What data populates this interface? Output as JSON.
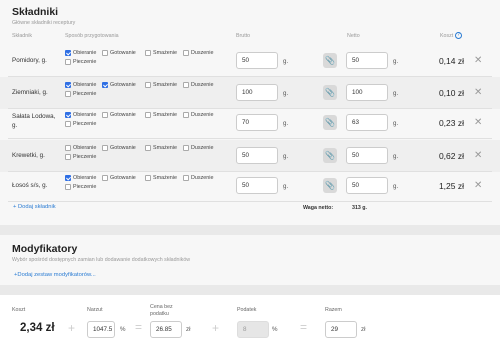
{
  "ingredients": {
    "title": "Składniki",
    "subtitle": "Główne składniki receptury",
    "headers": {
      "name": "Składnik",
      "method": "Sposób przygotowania",
      "brutto": "Brutto",
      "netto": "Netto",
      "cost": "Koszt"
    },
    "help_icon": "?",
    "method_labels": [
      "Obieranie",
      "Gotowanie",
      "Smażenie",
      "Duszenie",
      "Pieczenie"
    ],
    "rows": [
      {
        "name": "Pomidory, g.",
        "checked": [
          true,
          false,
          false,
          false,
          false
        ],
        "brutto": "50",
        "brutto_unit": "g.",
        "netto": "50",
        "netto_unit": "g.",
        "cost": "0,14 zł",
        "has_clip": true
      },
      {
        "name": "Ziemniaki, g.",
        "checked": [
          true,
          true,
          false,
          false,
          false
        ],
        "brutto": "100",
        "brutto_unit": "g.",
        "netto": "100",
        "netto_unit": "g.",
        "cost": "0,10 zł",
        "has_clip": true
      },
      {
        "name": "Sałata Lodowa, g.",
        "checked": [
          true,
          false,
          false,
          false,
          false
        ],
        "brutto": "70",
        "brutto_unit": "g.",
        "netto": "63",
        "netto_unit": "g.",
        "cost": "0,23 zł",
        "has_clip": true
      },
      {
        "name": "Krewetki, g.",
        "checked": [
          false,
          false,
          false,
          false,
          false
        ],
        "brutto": "50",
        "brutto_unit": "g.",
        "netto": "50",
        "netto_unit": "g.",
        "cost": "0,62 zł",
        "has_clip": true
      },
      {
        "name": "Łosoś s/s, g.",
        "checked": [
          true,
          false,
          false,
          false,
          false
        ],
        "brutto": "50",
        "brutto_unit": "g.",
        "netto": "50",
        "netto_unit": "g.",
        "cost": "1,25 zł",
        "has_clip": true
      }
    ],
    "add_label": "+ Dodaj składnik",
    "weight_label": "Waga netto:",
    "weight_value": "313 g.",
    "delete_icon": "✕",
    "clip_icon": "📎"
  },
  "modifiers": {
    "title": "Modyfikatory",
    "subtitle": "Wybór spośród dostępnych zamian lub dodawanie dodatkowych składników",
    "add_label": "+Dodaj zestaw modyfikatorów..."
  },
  "cost": {
    "koszt_label": "Koszt",
    "koszt_value": "2,34 zł",
    "narzut_label": "Narzut",
    "narzut_value": "1047.5",
    "narzut_unit": "%",
    "cena_label_1": "Cena bez",
    "cena_label_2": "podatku",
    "cena_value": "26.85",
    "cena_unit": "zł",
    "podatek_label": "Podatek",
    "podatek_value": "8",
    "podatek_unit": "%",
    "razem_label": "Razem",
    "razem_value": "29",
    "razem_unit": "zł",
    "op_plus": "+",
    "op_eq": "="
  },
  "colors": {
    "accent": "#2f6fe4",
    "link": "#2b7cd3"
  }
}
